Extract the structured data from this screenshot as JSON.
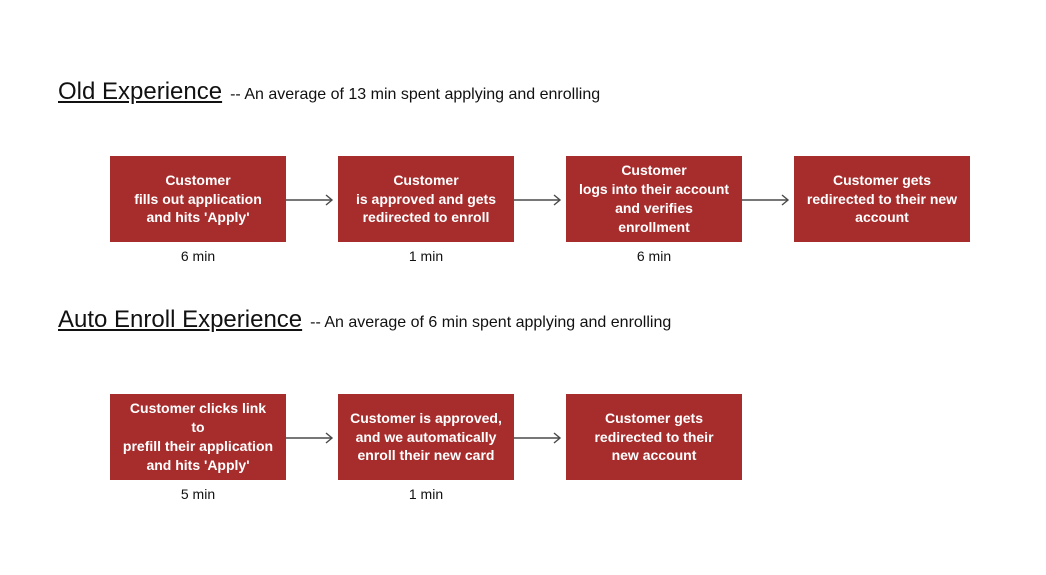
{
  "colors": {
    "box_bg": "#a72d2d",
    "box_text": "#ffffff",
    "arrow": "#4a4a4a",
    "page_bg": "#ffffff",
    "text": "#111111"
  },
  "sections": {
    "old": {
      "title": "Old Experience",
      "subtitle": " -- An average of 13 min spent applying and enrolling",
      "steps": [
        {
          "label": "Customer\nfills out application\nand hits 'Apply'",
          "time": "6 min"
        },
        {
          "label": "Customer\nis approved and gets\nredirected to enroll",
          "time": "1 min"
        },
        {
          "label": "Customer\nlogs into their account\nand verifies\nenrollment",
          "time": "6 min"
        },
        {
          "label": "Customer gets\nredirected to their new\naccount",
          "time": ""
        }
      ]
    },
    "auto": {
      "title": "Auto Enroll Experience",
      "subtitle": " -- An average of 6 min spent applying and enrolling",
      "steps": [
        {
          "label": "Customer clicks link to\nprefill their application\nand hits 'Apply'",
          "time": "5 min"
        },
        {
          "label": "Customer is approved,\nand we automatically\nenroll their new card",
          "time": "1 min"
        },
        {
          "label": "Customer gets\nredirected to their\nnew account",
          "time": ""
        }
      ]
    }
  }
}
